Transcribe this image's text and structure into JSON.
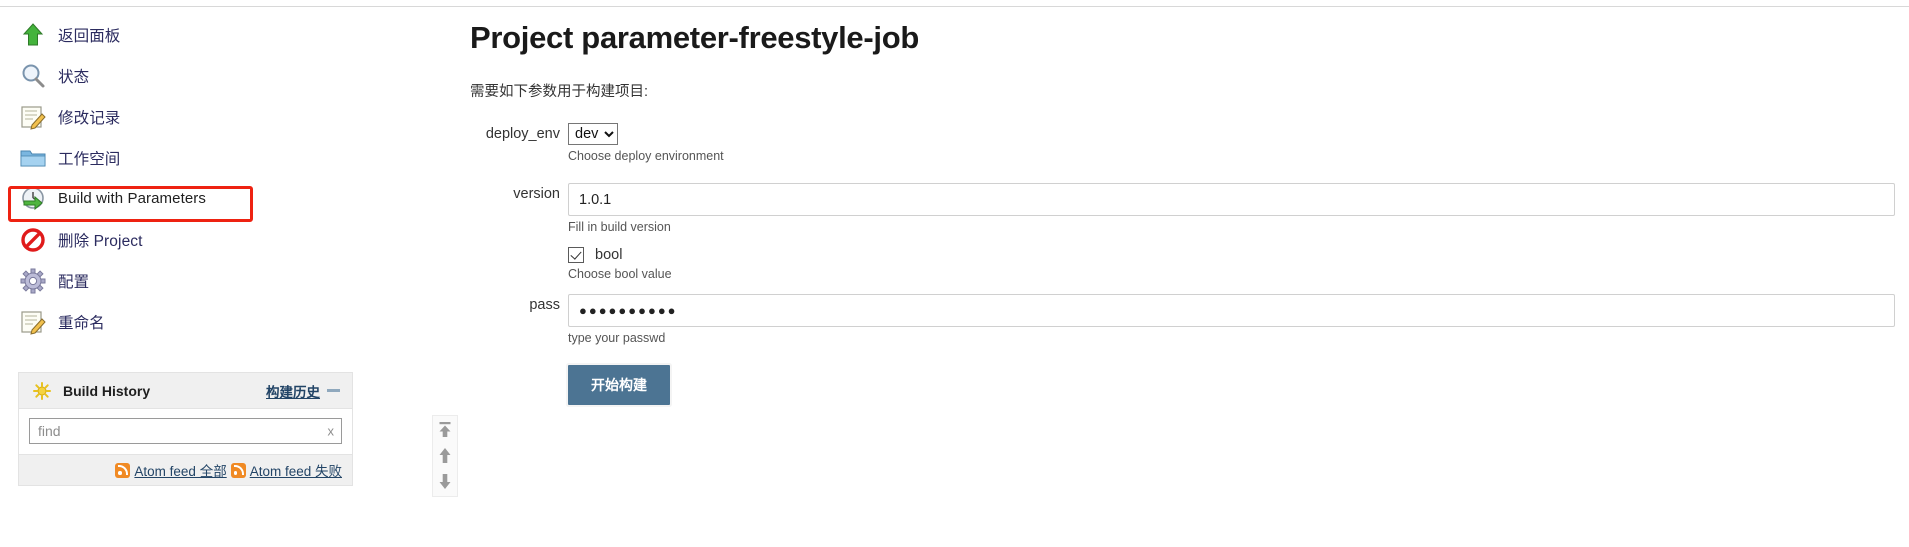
{
  "sidebar": {
    "tasks": [
      {
        "label": "返回面板",
        "icon": "up-arrow-icon",
        "latin": false
      },
      {
        "label": "状态",
        "icon": "magnifier-icon",
        "latin": false
      },
      {
        "label": "修改记录",
        "icon": "changelog-icon",
        "latin": false
      },
      {
        "label": "工作空间",
        "icon": "folder-icon",
        "latin": false
      },
      {
        "label": "Build with Parameters",
        "icon": "build-clock-icon",
        "latin": true
      },
      {
        "label": "删除 Project",
        "icon": "delete-prohibit-icon",
        "latin": false
      },
      {
        "label": "配置",
        "icon": "gear-icon",
        "latin": false
      },
      {
        "label": "重命名",
        "icon": "rename-icon",
        "latin": false
      }
    ],
    "highlighted_task": "Build with Parameters",
    "highlight_color": "#ee2211",
    "build_history": {
      "title": "Build History",
      "icon": "sun-icon",
      "link_label": "构建历史",
      "collapse_icon": "minus-icon",
      "find_placeholder": "find",
      "find_value": "",
      "find_clear_label": "x",
      "feeds": [
        {
          "label": "Atom feed 全部",
          "icon": "rss-icon"
        },
        {
          "label": "Atom feed 失败",
          "icon": "rss-icon"
        }
      ]
    },
    "scroll_controls": [
      {
        "name": "scroll-to-top-icon"
      },
      {
        "name": "scroll-up-icon"
      },
      {
        "name": "scroll-down-icon"
      }
    ]
  },
  "main": {
    "title": "Project parameter-freestyle-job",
    "intro": "需要如下参数用于构建项目:",
    "parameters": [
      {
        "name": "deploy_env",
        "type": "select",
        "value": "dev",
        "options": [
          "dev"
        ],
        "description": "Choose deploy environment"
      },
      {
        "name": "version",
        "type": "text",
        "value": "1.0.1",
        "description": "Fill in build version"
      },
      {
        "name": "bool",
        "type": "checkbox",
        "checked": true,
        "checkbox_label": "bool",
        "description": "Choose bool value"
      },
      {
        "name": "pass",
        "type": "password",
        "value": "●●●●●●●●●●",
        "description": "type your passwd"
      }
    ],
    "submit_label": "开始构建",
    "submit_color": "#4c7493"
  }
}
